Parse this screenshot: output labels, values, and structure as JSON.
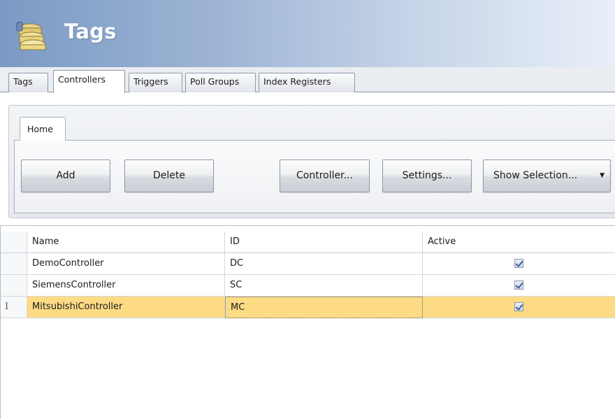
{
  "header": {
    "title": "Tags",
    "icon": "tags-stack-icon"
  },
  "tabs": [
    {
      "label": "Tags",
      "active": false
    },
    {
      "label": "Controllers",
      "active": true
    },
    {
      "label": "Triggers",
      "active": false
    },
    {
      "label": "Poll Groups",
      "active": false
    },
    {
      "label": "Index Registers",
      "active": false
    }
  ],
  "ribbon": {
    "home_tab": "Home",
    "add_label": "Add",
    "delete_label": "Delete",
    "controller_label": "Controller...",
    "settings_label": "Settings...",
    "show_selection_label": "Show Selection...",
    "dropdown_glyph": "▼"
  },
  "grid": {
    "columns": [
      "Name",
      "ID",
      "Active"
    ],
    "rows": [
      {
        "name": "DemoController",
        "id": "DC",
        "active": true,
        "marker": ""
      },
      {
        "name": "SiemensController",
        "id": "SC",
        "active": true,
        "marker": ""
      },
      {
        "name": "MitsubishiController",
        "id": "MC",
        "active": true,
        "marker": "I"
      }
    ]
  },
  "colors": {
    "selected_row": "#fddb85",
    "header_gradient_start": "#7b9ac4"
  }
}
